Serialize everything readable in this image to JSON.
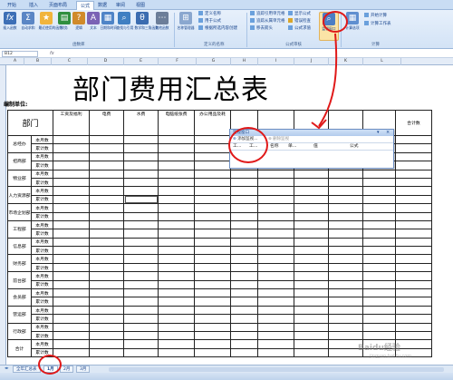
{
  "ribbon": {
    "tabs": [
      "开始",
      "插入",
      "页面布局",
      "公式",
      "数据",
      "审阅",
      "视图"
    ],
    "active_tab": "公式",
    "buttons": {
      "insert_function": "插入函数",
      "autosum": "自动求和",
      "recent": "最近使用的函数",
      "finance": "财务",
      "logic": "逻辑",
      "text": "文本",
      "datetime": "日期和时间",
      "lookup": "查找与引用",
      "math": "数学和三角函数",
      "more": "其他函数",
      "name_manager": "名称管理器",
      "watch_window": "监视窗口",
      "calc_options": "计算选项"
    },
    "small_items": {
      "define_name": "定义名称",
      "use_in_formula": "用于公式",
      "create_from_sel": "根据所选内容创建",
      "trace_precedents": "追踪引用单元格",
      "trace_dependents": "追踪从属单元格",
      "remove_arrows": "移去箭头",
      "show_formulas": "显示公式",
      "error_check": "错误检查",
      "evaluate_formula": "公式求值",
      "calc_now": "开始计算",
      "calc_sheet": "计算工作表"
    },
    "groups": {
      "function_library": "函数库",
      "defined_names": "定义的名称",
      "formula_auditing": "公式审核",
      "calculation": "计算"
    }
  },
  "formula_bar": {
    "name_box": "B12",
    "fx": "fx"
  },
  "columns": [
    "A",
    "B",
    "C",
    "D",
    "E",
    "F",
    "G",
    "H",
    "I",
    "J",
    "K",
    "L"
  ],
  "sheet": {
    "title": "部门费用汇总表",
    "unit_label": "编制单位:",
    "dept_header": "部门",
    "expense_headers": [
      "工资及福利",
      "电费",
      "水费",
      "电脑纸张费",
      "办公用品及耗",
      "",
      "",
      "",
      "",
      ""
    ],
    "total_header": "合计数",
    "sub_rows": [
      "本月数",
      "累计数"
    ],
    "departments": [
      "总经办",
      "招商部",
      "物业部",
      "人力资源部",
      "市场企划部",
      "工程部",
      "信息部",
      "财务部",
      "前台部",
      "会员部",
      "营运部",
      "行政部",
      "合计"
    ]
  },
  "watch_window": {
    "title": "监视窗口",
    "add_watch": "添加监视...",
    "delete_watch": "删除监视",
    "columns": [
      "工...",
      "工...",
      "名称",
      "单...",
      "值",
      "公式"
    ]
  },
  "sheet_tabs": [
    "全年汇总表",
    "1月",
    "2月",
    "3月"
  ],
  "watermark": {
    "main": "Baidu经验",
    "sub": "jingyan.baidu.com"
  }
}
